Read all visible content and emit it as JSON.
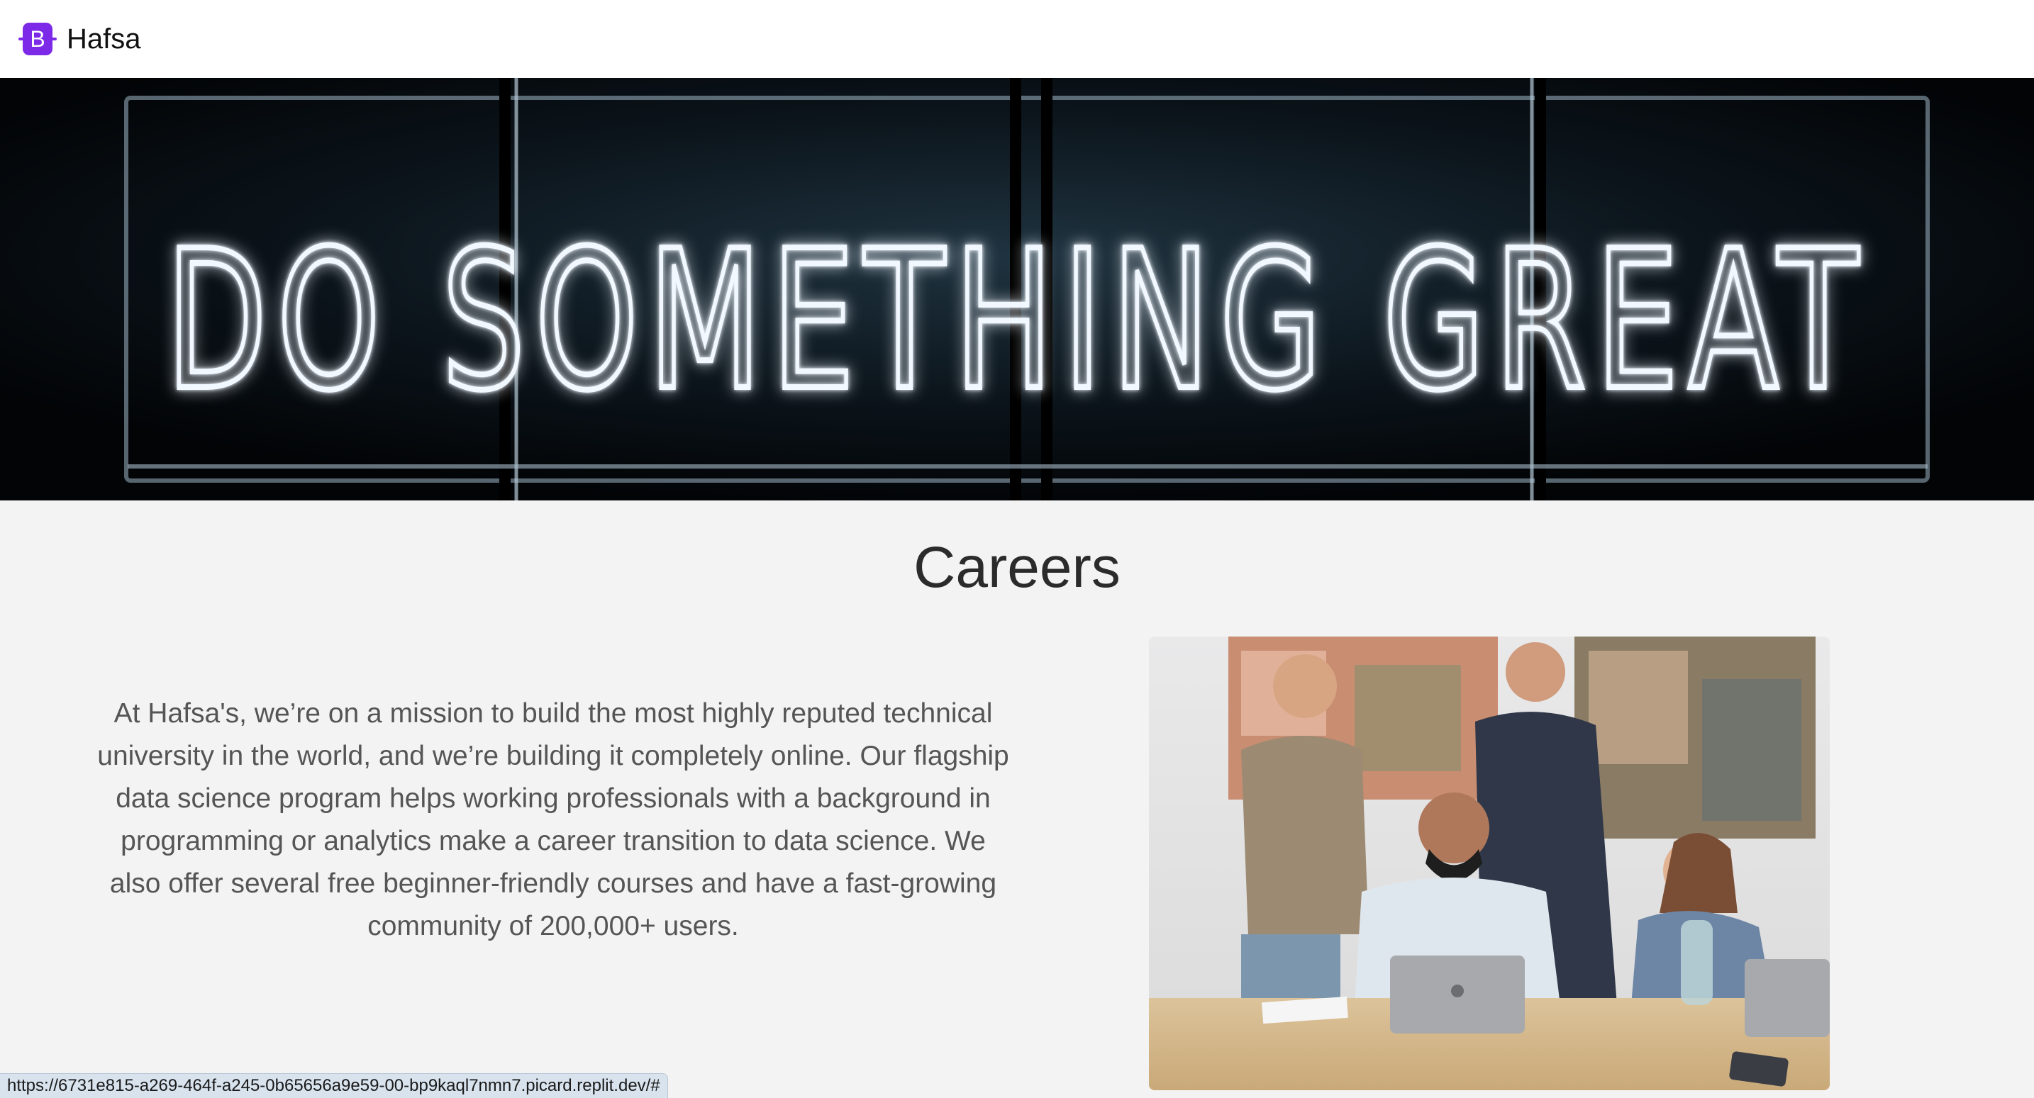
{
  "navbar": {
    "brand_letter": "B",
    "brand_name": "Hafsa",
    "brand_color": "#7c2ae8"
  },
  "hero": {
    "neon_text": "DO SOMETHING GREAT"
  },
  "main": {
    "title": "Careers",
    "about_text": "At Hafsa's, we’re on a mission to build the most highly reputed technical university in the world, and we’re building it completely online. Our flagship data science program helps working professionals with a background in programming or analytics make a career transition to data science. We also offer several free beginner-friendly courses and have a fast-growing community of 200,000+ users."
  },
  "status_bar": {
    "url": "https://6731e815-a269-464f-a245-0b65656a9e59-00-bp9kaql7nmn7.picard.replit.dev/#"
  }
}
